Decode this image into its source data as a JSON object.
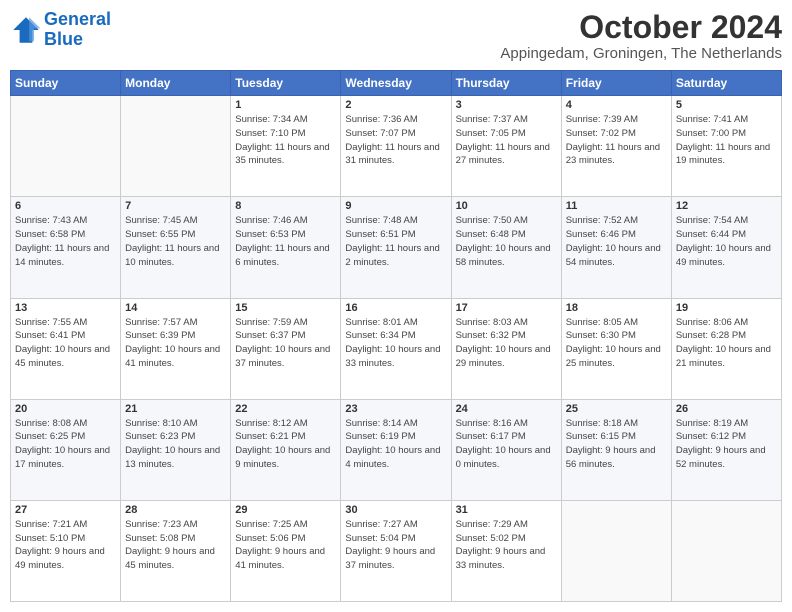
{
  "header": {
    "logo_line1": "General",
    "logo_line2": "Blue",
    "title": "October 2024",
    "subtitle": "Appingedam, Groningen, The Netherlands"
  },
  "weekdays": [
    "Sunday",
    "Monday",
    "Tuesday",
    "Wednesday",
    "Thursday",
    "Friday",
    "Saturday"
  ],
  "weeks": [
    [
      {
        "day": "",
        "info": ""
      },
      {
        "day": "",
        "info": ""
      },
      {
        "day": "1",
        "info": "Sunrise: 7:34 AM\nSunset: 7:10 PM\nDaylight: 11 hours and 35 minutes."
      },
      {
        "day": "2",
        "info": "Sunrise: 7:36 AM\nSunset: 7:07 PM\nDaylight: 11 hours and 31 minutes."
      },
      {
        "day": "3",
        "info": "Sunrise: 7:37 AM\nSunset: 7:05 PM\nDaylight: 11 hours and 27 minutes."
      },
      {
        "day": "4",
        "info": "Sunrise: 7:39 AM\nSunset: 7:02 PM\nDaylight: 11 hours and 23 minutes."
      },
      {
        "day": "5",
        "info": "Sunrise: 7:41 AM\nSunset: 7:00 PM\nDaylight: 11 hours and 19 minutes."
      }
    ],
    [
      {
        "day": "6",
        "info": "Sunrise: 7:43 AM\nSunset: 6:58 PM\nDaylight: 11 hours and 14 minutes."
      },
      {
        "day": "7",
        "info": "Sunrise: 7:45 AM\nSunset: 6:55 PM\nDaylight: 11 hours and 10 minutes."
      },
      {
        "day": "8",
        "info": "Sunrise: 7:46 AM\nSunset: 6:53 PM\nDaylight: 11 hours and 6 minutes."
      },
      {
        "day": "9",
        "info": "Sunrise: 7:48 AM\nSunset: 6:51 PM\nDaylight: 11 hours and 2 minutes."
      },
      {
        "day": "10",
        "info": "Sunrise: 7:50 AM\nSunset: 6:48 PM\nDaylight: 10 hours and 58 minutes."
      },
      {
        "day": "11",
        "info": "Sunrise: 7:52 AM\nSunset: 6:46 PM\nDaylight: 10 hours and 54 minutes."
      },
      {
        "day": "12",
        "info": "Sunrise: 7:54 AM\nSunset: 6:44 PM\nDaylight: 10 hours and 49 minutes."
      }
    ],
    [
      {
        "day": "13",
        "info": "Sunrise: 7:55 AM\nSunset: 6:41 PM\nDaylight: 10 hours and 45 minutes."
      },
      {
        "day": "14",
        "info": "Sunrise: 7:57 AM\nSunset: 6:39 PM\nDaylight: 10 hours and 41 minutes."
      },
      {
        "day": "15",
        "info": "Sunrise: 7:59 AM\nSunset: 6:37 PM\nDaylight: 10 hours and 37 minutes."
      },
      {
        "day": "16",
        "info": "Sunrise: 8:01 AM\nSunset: 6:34 PM\nDaylight: 10 hours and 33 minutes."
      },
      {
        "day": "17",
        "info": "Sunrise: 8:03 AM\nSunset: 6:32 PM\nDaylight: 10 hours and 29 minutes."
      },
      {
        "day": "18",
        "info": "Sunrise: 8:05 AM\nSunset: 6:30 PM\nDaylight: 10 hours and 25 minutes."
      },
      {
        "day": "19",
        "info": "Sunrise: 8:06 AM\nSunset: 6:28 PM\nDaylight: 10 hours and 21 minutes."
      }
    ],
    [
      {
        "day": "20",
        "info": "Sunrise: 8:08 AM\nSunset: 6:25 PM\nDaylight: 10 hours and 17 minutes."
      },
      {
        "day": "21",
        "info": "Sunrise: 8:10 AM\nSunset: 6:23 PM\nDaylight: 10 hours and 13 minutes."
      },
      {
        "day": "22",
        "info": "Sunrise: 8:12 AM\nSunset: 6:21 PM\nDaylight: 10 hours and 9 minutes."
      },
      {
        "day": "23",
        "info": "Sunrise: 8:14 AM\nSunset: 6:19 PM\nDaylight: 10 hours and 4 minutes."
      },
      {
        "day": "24",
        "info": "Sunrise: 8:16 AM\nSunset: 6:17 PM\nDaylight: 10 hours and 0 minutes."
      },
      {
        "day": "25",
        "info": "Sunrise: 8:18 AM\nSunset: 6:15 PM\nDaylight: 9 hours and 56 minutes."
      },
      {
        "day": "26",
        "info": "Sunrise: 8:19 AM\nSunset: 6:12 PM\nDaylight: 9 hours and 52 minutes."
      }
    ],
    [
      {
        "day": "27",
        "info": "Sunrise: 7:21 AM\nSunset: 5:10 PM\nDaylight: 9 hours and 49 minutes."
      },
      {
        "day": "28",
        "info": "Sunrise: 7:23 AM\nSunset: 5:08 PM\nDaylight: 9 hours and 45 minutes."
      },
      {
        "day": "29",
        "info": "Sunrise: 7:25 AM\nSunset: 5:06 PM\nDaylight: 9 hours and 41 minutes."
      },
      {
        "day": "30",
        "info": "Sunrise: 7:27 AM\nSunset: 5:04 PM\nDaylight: 9 hours and 37 minutes."
      },
      {
        "day": "31",
        "info": "Sunrise: 7:29 AM\nSunset: 5:02 PM\nDaylight: 9 hours and 33 minutes."
      },
      {
        "day": "",
        "info": ""
      },
      {
        "day": "",
        "info": ""
      }
    ]
  ]
}
